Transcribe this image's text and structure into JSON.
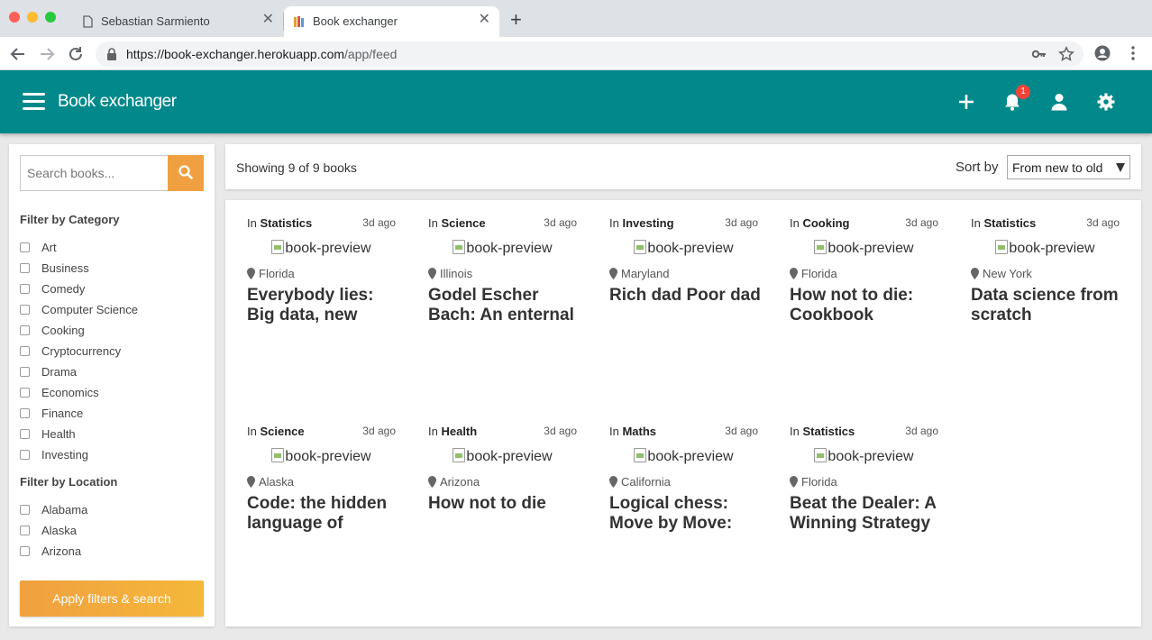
{
  "browser": {
    "tabs": [
      {
        "title": "Sebastian Sarmiento",
        "favicon": "document-icon",
        "active": false
      },
      {
        "title": "Book exchanger",
        "favicon": "books-icon",
        "active": true
      }
    ],
    "url_domain": "https://book-exchanger.herokuapp.com",
    "url_path": "/app/feed"
  },
  "header": {
    "brand": "Book exchanger",
    "notification_count": "1",
    "accent_color": "#00888a"
  },
  "sidebar": {
    "search_placeholder": "Search books...",
    "category_title": "Filter by Category",
    "categories": [
      "Art",
      "Business",
      "Comedy",
      "Computer Science",
      "Cooking",
      "Cryptocurrency",
      "Drama",
      "Economics",
      "Finance",
      "Health",
      "Investing"
    ],
    "location_title": "Filter by Location",
    "locations": [
      "Alabama",
      "Alaska",
      "Arizona"
    ],
    "apply_label": "Apply filters & search"
  },
  "toolbar": {
    "showing": "Showing 9 of 9 books",
    "sort_label": "Sort by",
    "sort_value": "From new to old"
  },
  "books": [
    {
      "in": "In",
      "category": "Statistics",
      "date": "3d ago",
      "image_alt": "book-preview",
      "location": "Florida",
      "title": "Everybody lies: Big data, new"
    },
    {
      "in": "In",
      "category": "Science",
      "date": "3d ago",
      "image_alt": "book-preview",
      "location": "Illinois",
      "title": "Godel Escher Bach: An enternal"
    },
    {
      "in": "In",
      "category": "Investing",
      "date": "3d ago",
      "image_alt": "book-preview",
      "location": "Maryland",
      "title": "Rich dad Poor dad"
    },
    {
      "in": "In",
      "category": "Cooking",
      "date": "3d ago",
      "image_alt": "book-preview",
      "location": "Florida",
      "title": "How not to die: Cookbook"
    },
    {
      "in": "In",
      "category": "Statistics",
      "date": "3d ago",
      "image_alt": "book-preview",
      "location": "New York",
      "title": "Data science from scratch"
    },
    {
      "in": "In",
      "category": "Science",
      "date": "3d ago",
      "image_alt": "book-preview",
      "location": "Alaska",
      "title": "Code: the hidden language of"
    },
    {
      "in": "In",
      "category": "Health",
      "date": "3d ago",
      "image_alt": "book-preview",
      "location": "Arizona",
      "title": "How not to die"
    },
    {
      "in": "In",
      "category": "Maths",
      "date": "3d ago",
      "image_alt": "book-preview",
      "location": "California",
      "title": "Logical chess: Move by Move:"
    },
    {
      "in": "In",
      "category": "Statistics",
      "date": "3d ago",
      "image_alt": "book-preview",
      "location": "Florida",
      "title": "Beat the Dealer: A Winning Strategy"
    }
  ]
}
